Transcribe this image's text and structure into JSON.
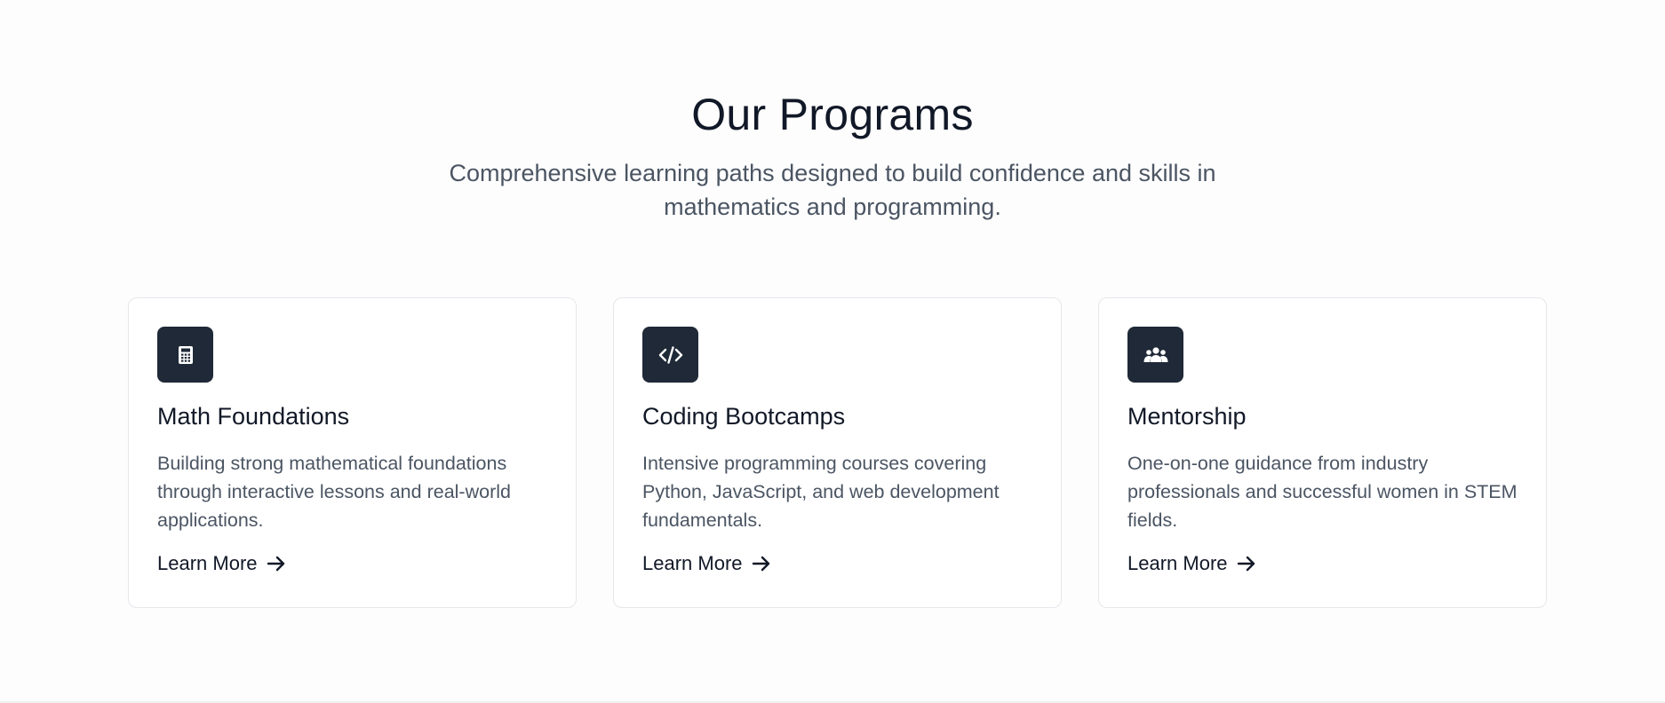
{
  "programs": {
    "title": "Our Programs",
    "subtitle": "Comprehensive learning paths designed to build confidence and skills in mathematics and programming.",
    "cards": [
      {
        "icon": "calculator-icon",
        "title": "Math Foundations",
        "description": "Building strong mathematical foundations through interactive lessons and real-world applications.",
        "link": "Learn More"
      },
      {
        "icon": "code-icon",
        "title": "Coding Bootcamps",
        "description": "Intensive programming courses covering Python, JavaScript, and web development fundamentals.",
        "link": "Learn More"
      },
      {
        "icon": "users-icon",
        "title": "Mentorship",
        "description": "One-on-one guidance from industry professionals and successful women in STEM fields.",
        "link": "Learn More"
      }
    ]
  },
  "colors": {
    "background": "#fdfdfd",
    "card_border": "#e5e7eb",
    "icon_bg": "#1f2937",
    "heading": "#111827",
    "body_text": "#4b5563"
  }
}
